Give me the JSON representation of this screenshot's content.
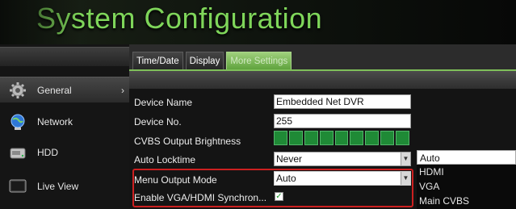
{
  "title": "System Configuration",
  "sidebar": {
    "items": [
      {
        "label": "General",
        "icon": "gear-icon",
        "active": true,
        "arrow": "›"
      },
      {
        "label": "Network",
        "icon": "network-globe-icon"
      },
      {
        "label": "HDD",
        "icon": "hdd-icon"
      },
      {
        "label": "Live View",
        "icon": "monitor-icon"
      }
    ]
  },
  "tabs": [
    {
      "label": "Time/Date"
    },
    {
      "label": "Display"
    },
    {
      "label": "More Settings",
      "active": true
    }
  ],
  "settings": {
    "device_name": {
      "label": "Device Name",
      "value": "Embedded Net DVR"
    },
    "device_no": {
      "label": "Device No.",
      "value": "255"
    },
    "cvbs_brightness": {
      "label": "CVBS Output Brightness",
      "level_fraction": 1.0
    },
    "auto_locktime": {
      "label": "Auto Locktime",
      "value": "Never"
    },
    "menu_output_mode": {
      "label": "Menu Output Mode",
      "value": "Auto"
    },
    "vga_hdmi_sync": {
      "label": "Enable VGA/HDMI Synchron...",
      "checked": true,
      "check_glyph": "✓"
    }
  },
  "dropdown": {
    "options": [
      "Auto",
      "HDMI",
      "VGA",
      "Main CVBS"
    ],
    "selected": "Auto"
  },
  "colors": {
    "title": "#7fd65a",
    "active_tab": "#5fa33d",
    "highlight_box": "#cc2020",
    "brightness_block": "#1f8a36"
  }
}
